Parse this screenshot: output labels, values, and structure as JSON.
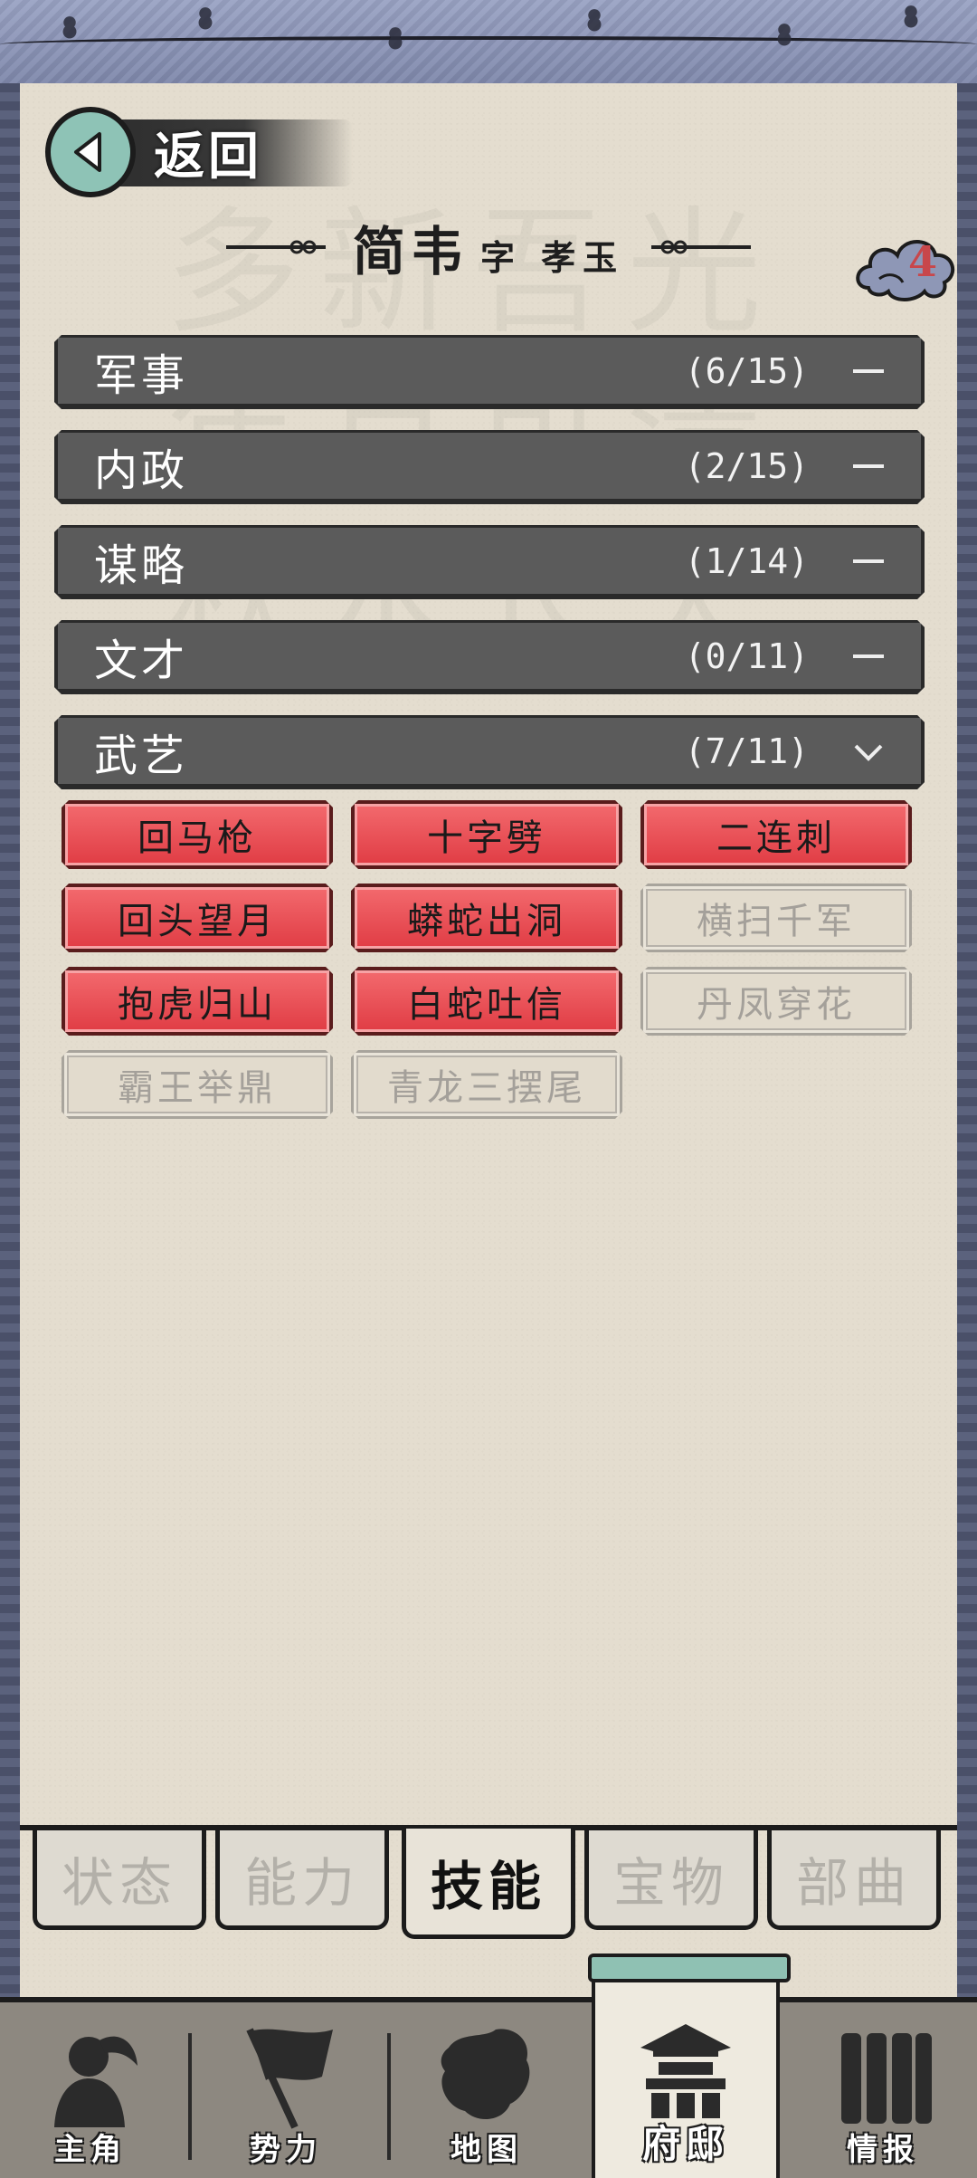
{
  "header": {
    "back_label": "返回",
    "name": "简韦",
    "courtesy": "字 孝玉",
    "badge_count": "4"
  },
  "categories": [
    {
      "name": "军事",
      "count": "(6/15)",
      "state": "collapsed"
    },
    {
      "name": "内政",
      "count": "(2/15)",
      "state": "collapsed"
    },
    {
      "name": "谋略",
      "count": "(1/14)",
      "state": "collapsed"
    },
    {
      "name": "文才",
      "count": "(0/11)",
      "state": "collapsed"
    },
    {
      "name": "武艺",
      "count": "(7/11)",
      "state": "expanded"
    }
  ],
  "skills": [
    {
      "label": "回马枪",
      "unlocked": true
    },
    {
      "label": "十字劈",
      "unlocked": true
    },
    {
      "label": "二连刺",
      "unlocked": true
    },
    {
      "label": "回头望月",
      "unlocked": true
    },
    {
      "label": "蟒蛇出洞",
      "unlocked": true
    },
    {
      "label": "横扫千军",
      "unlocked": false
    },
    {
      "label": "抱虎归山",
      "unlocked": true
    },
    {
      "label": "白蛇吐信",
      "unlocked": true
    },
    {
      "label": "丹凤穿花",
      "unlocked": false
    },
    {
      "label": "霸王举鼎",
      "unlocked": false
    },
    {
      "label": "青龙三摆尾",
      "unlocked": false
    }
  ],
  "tabs": [
    {
      "label": "状态",
      "active": false
    },
    {
      "label": "能力",
      "active": false
    },
    {
      "label": "技能",
      "active": true
    },
    {
      "label": "宝物",
      "active": false
    },
    {
      "label": "部曲",
      "active": false
    }
  ],
  "bottom_nav": [
    {
      "label": "主角",
      "icon": "warrior-icon",
      "active": false
    },
    {
      "label": "势力",
      "icon": "flag-icon",
      "active": false
    },
    {
      "label": "地图",
      "icon": "map-icon",
      "active": false
    },
    {
      "label": "府邸",
      "icon": "mansion-icon",
      "active": true
    },
    {
      "label": "情报",
      "icon": "scroll-icon",
      "active": false
    }
  ],
  "colors": {
    "skill_on": "#e8454c",
    "skill_off": "#e2dbcd",
    "category_bar": "#5b5b5b",
    "paper": "#e4ddcf",
    "frame": "#4b5168"
  }
}
